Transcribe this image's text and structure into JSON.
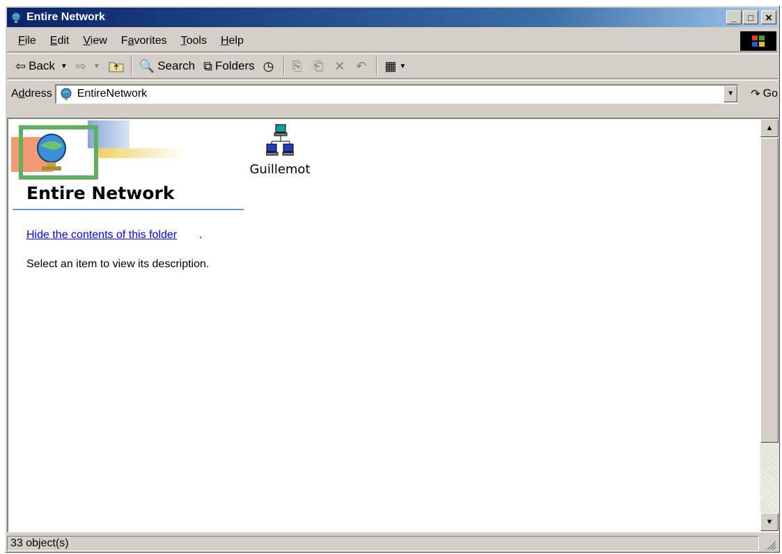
{
  "window": {
    "title": "Entire Network"
  },
  "menubar": {
    "items": [
      {
        "id": "file",
        "u": "F",
        "rest": "ile"
      },
      {
        "id": "edit",
        "u": "E",
        "rest": "dit"
      },
      {
        "id": "view",
        "u": "V",
        "rest": "iew"
      },
      {
        "id": "favorites",
        "pre": "F",
        "u": "a",
        "rest": "vorites"
      },
      {
        "id": "tools",
        "u": "T",
        "rest": "ools"
      },
      {
        "id": "help",
        "u": "H",
        "rest": "elp"
      }
    ],
    "items_flat": {
      "file": {
        "u": "F",
        "rest": "ile"
      },
      "edit": {
        "u": "E",
        "rest": "dit"
      },
      "view": {
        "u": "V",
        "rest": "iew"
      },
      "favorites": {
        "pre": "F",
        "u": "a",
        "rest": "vorites"
      },
      "tools": {
        "u": "T",
        "rest": "ools"
      },
      "help": {
        "u": "H",
        "rest": "elp"
      }
    }
  },
  "toolbar": {
    "back_label": "Back",
    "search_label": "Search",
    "folders_label": "Folders"
  },
  "address": {
    "label_pre": "A",
    "label_u": "d",
    "label_rest": "dress",
    "value": "EntireNetwork",
    "go_label": "Go"
  },
  "panel": {
    "title": "Entire Network",
    "hide_link": "Hide the contents of this folder",
    "hide_period": ".",
    "description": "Select an item to view its description."
  },
  "items": [
    {
      "label": "Guillemot",
      "icon": "network-computers-icon"
    }
  ],
  "status": {
    "text": "33 object(s)"
  },
  "colors": {
    "titlebar_start": "#0a246a",
    "titlebar_end": "#a6caf0",
    "link": "#0000ee",
    "chrome": "#d4d0c8"
  }
}
